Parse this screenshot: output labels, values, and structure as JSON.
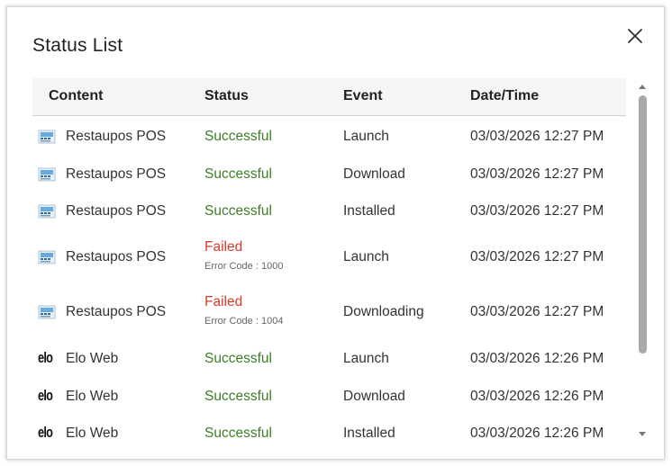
{
  "dialog": {
    "title": "Status List"
  },
  "table": {
    "headers": [
      "Content",
      "Status",
      "Event",
      "Date/Time"
    ],
    "rows": [
      {
        "content": "Restaupos POS",
        "icon": "restaupos-app-icon",
        "status": "Successful",
        "status_type": "success",
        "error": "",
        "event": "Launch",
        "datetime": "03/03/2026 12:27 PM"
      },
      {
        "content": "Restaupos POS",
        "icon": "restaupos-app-icon",
        "status": "Successful",
        "status_type": "success",
        "error": "",
        "event": "Download",
        "datetime": "03/03/2026 12:27 PM"
      },
      {
        "content": "Restaupos POS",
        "icon": "restaupos-app-icon",
        "status": "Successful",
        "status_type": "success",
        "error": "",
        "event": "Installed",
        "datetime": "03/03/2026 12:27 PM"
      },
      {
        "content": "Restaupos POS",
        "icon": "restaupos-app-icon",
        "status": "Failed",
        "status_type": "fail",
        "error": "Error Code : 1000",
        "event": "Launch",
        "datetime": "03/03/2026 12:27 PM"
      },
      {
        "content": "Restaupos POS",
        "icon": "restaupos-app-icon",
        "status": "Failed",
        "status_type": "fail",
        "error": "Error Code : 1004",
        "event": "Downloading",
        "datetime": "03/03/2026 12:27 PM"
      },
      {
        "content": "Elo Web",
        "icon": "elo-logo-icon",
        "icon_text": "elo",
        "status": "Successful",
        "status_type": "success",
        "error": "",
        "event": "Launch",
        "datetime": "03/03/2026 12:26 PM"
      },
      {
        "content": "Elo Web",
        "icon": "elo-logo-icon",
        "icon_text": "elo",
        "status": "Successful",
        "status_type": "success",
        "error": "",
        "event": "Download",
        "datetime": "03/03/2026 12:26 PM"
      },
      {
        "content": "Elo Web",
        "icon": "elo-logo-icon",
        "icon_text": "elo",
        "status": "Successful",
        "status_type": "success",
        "error": "",
        "event": "Installed",
        "datetime": "03/03/2026 12:26 PM"
      }
    ]
  },
  "colors": {
    "success": "#3c7d26",
    "fail": "#d9392b",
    "header_bg": "#f5f5f5"
  },
  "icons": {
    "close": "close-icon",
    "scroll_up": "scroll-up-arrow-icon",
    "scroll_down": "scroll-down-arrow-icon"
  }
}
